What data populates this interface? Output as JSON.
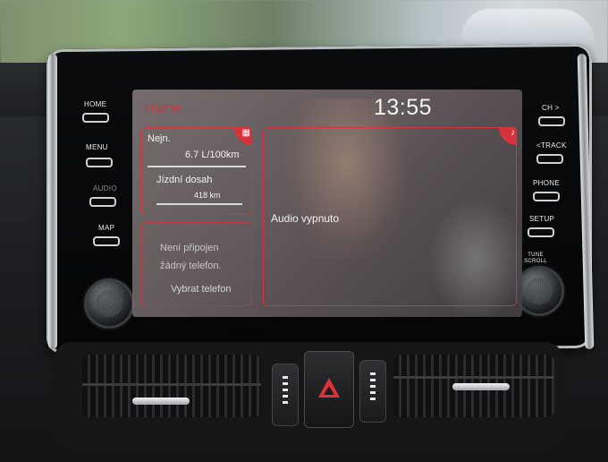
{
  "screen": {
    "title": "Home",
    "clock": "13:55",
    "fuel_tile": {
      "label": "Nejn.",
      "consumption": "6.7 L/100km",
      "range_label": "Jízdní dosah",
      "range_value": "418 km",
      "icon": "fuel-gauge-icon"
    },
    "phone_tile": {
      "line1": "Není připojen",
      "line2": "žádný telefon.",
      "action": "Vybrat telefon"
    },
    "audio_tile": {
      "status": "Audio vypnuto",
      "icon": "music-note-icon"
    }
  },
  "hard_keys": {
    "left": [
      "HOME",
      "MENU",
      "AUDIO",
      "MAP"
    ],
    "right": [
      "CH >",
      "<TRACK",
      "PHONE",
      "SETUP"
    ],
    "knob_right_label": "TUNE SCROLL"
  },
  "colors": {
    "accent": "#d8323c",
    "screen_text": "#f2f2f2"
  }
}
